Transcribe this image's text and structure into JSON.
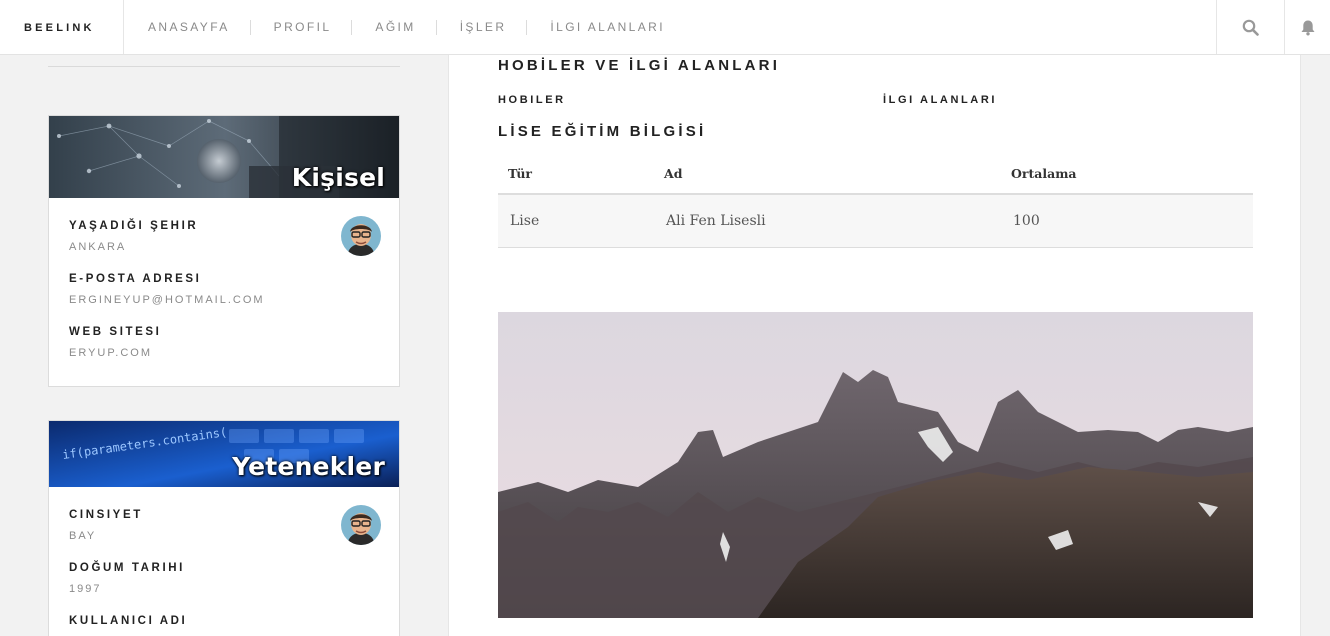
{
  "brand": "BEELINK",
  "nav": {
    "items": [
      "ANASAYFA",
      "PROFIL",
      "AĞIM",
      "İŞLER",
      "İLGI ALANLARI"
    ],
    "search_icon": "search-icon",
    "notification_icon": "bell-icon"
  },
  "sidebar": {
    "personal_card": {
      "banner_title": "Kişisel",
      "fields": [
        {
          "label": "YAŞADIĞI ŞEHIR",
          "value": "ANKARA"
        },
        {
          "label": "E-POSTA ADRESI",
          "value": "ERGINEYUP@HOTMAIL.COM"
        },
        {
          "label": "WEB SITESI",
          "value": "ERYUP.COM"
        }
      ]
    },
    "skills_card": {
      "banner_title": "Yetenekler",
      "banner_code": "if(parameters.contains(",
      "fields": [
        {
          "label": "CINSIYET",
          "value": "BAY"
        },
        {
          "label": "DOĞUM TARIHI",
          "value": "1997"
        },
        {
          "label": "KULLANICI ADI",
          "value": ""
        }
      ]
    }
  },
  "main": {
    "hobbies_title": "HOBİLER VE İLGİ ALANLARI",
    "hobbies_label": "HOBILER",
    "interests_label": "İLGI ALANLARI",
    "education_title": "LİSE EĞİTİM BİLGİSİ",
    "education_table": {
      "headers": [
        "Tür",
        "Ad",
        "Ortalama"
      ],
      "rows": [
        [
          "Lise",
          "Ali Fen Lisesli",
          "100"
        ]
      ]
    }
  }
}
